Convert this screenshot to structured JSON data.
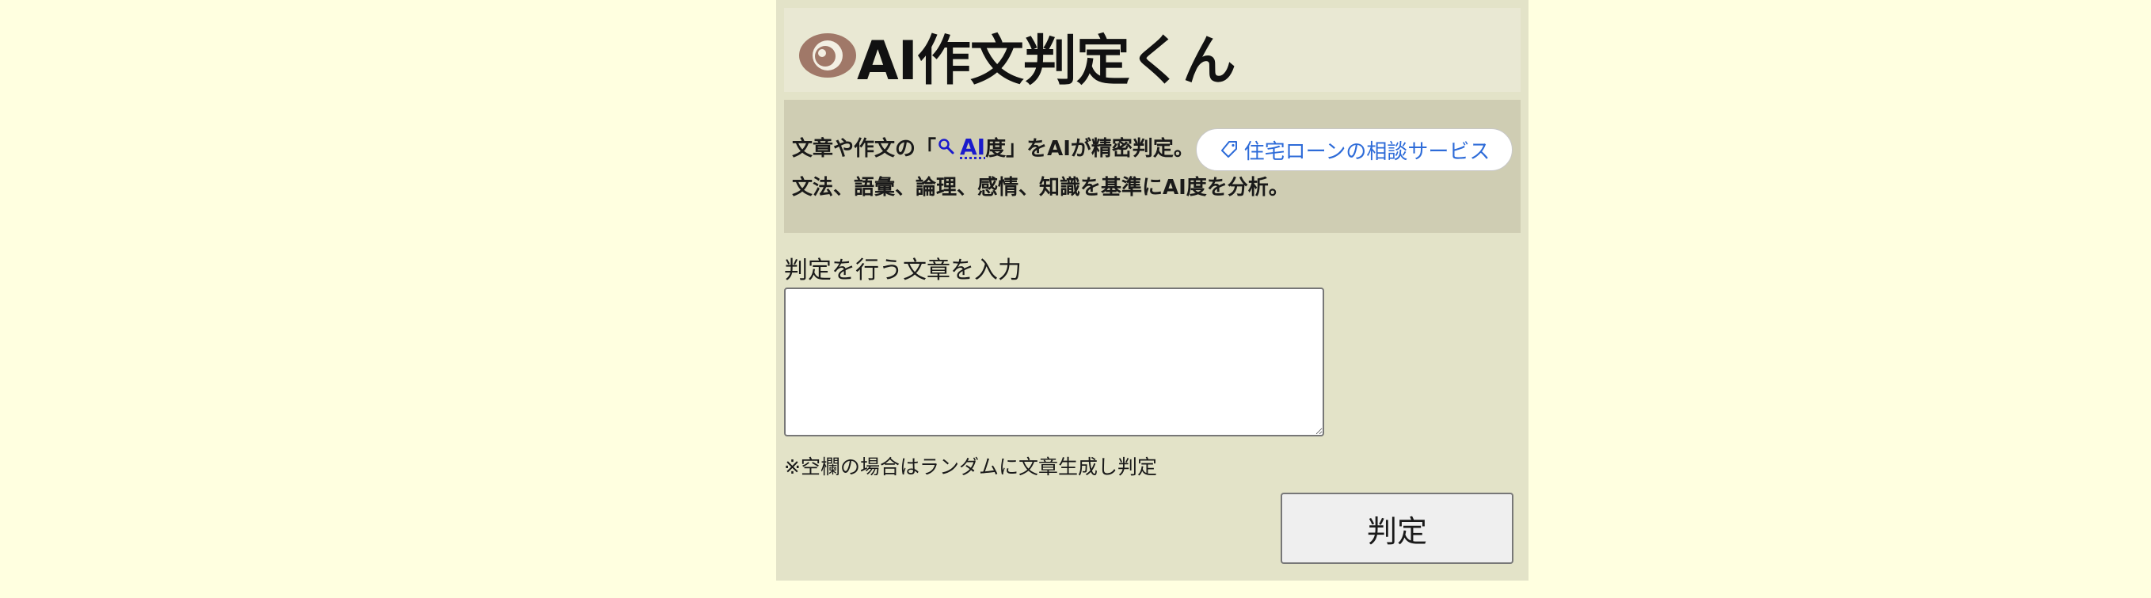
{
  "header": {
    "title": "AI作文判定くん",
    "logo_icon": "eye-icon"
  },
  "description": {
    "line1_prefix": "文章や作文の「",
    "search_icon": "magnifier-icon",
    "ai_link": "AI",
    "line1_suffix": "度」をAIが精密判定。",
    "line2": "文法、語彙、論理、感情、知識を基準にAI度を分析。",
    "tag_button": {
      "icon": "tag-icon",
      "label": "住宅ローンの相談サービス"
    }
  },
  "form": {
    "input_label": "判定を行う文章を入力",
    "textarea_value": "",
    "note": "※空欄の場合はランダムに文章生成し判定",
    "submit_label": "判定"
  },
  "colors": {
    "page_background": "#ffffe0",
    "panel_background": "#e3e3c8",
    "header_background": "#e9e8d3",
    "description_background": "#cfcdb3",
    "eye_icon": "#a07868",
    "link_blue": "#1a1acc",
    "tag_text": "#2d6bd8"
  }
}
